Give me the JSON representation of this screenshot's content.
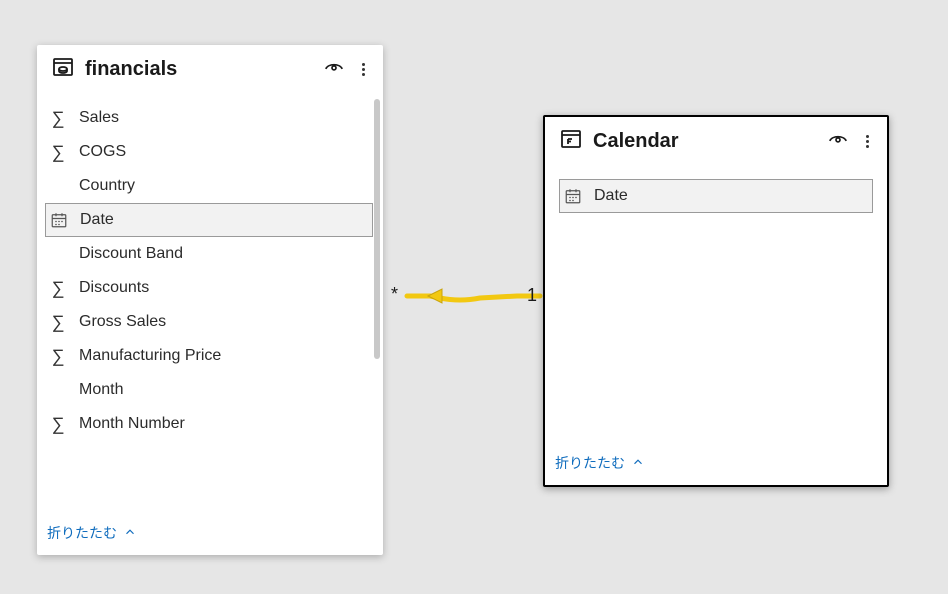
{
  "tables": {
    "financials": {
      "title": "financials",
      "collapse_label": "折りたたむ",
      "fields": [
        {
          "name": "Sales",
          "icon": "sigma",
          "highlight": false
        },
        {
          "name": "COGS",
          "icon": "sigma",
          "highlight": false
        },
        {
          "name": "Country",
          "icon": null,
          "highlight": false
        },
        {
          "name": "Date",
          "icon": "calendar",
          "highlight": true
        },
        {
          "name": "Discount Band",
          "icon": null,
          "highlight": false
        },
        {
          "name": "Discounts",
          "icon": "sigma",
          "highlight": false
        },
        {
          "name": "Gross Sales",
          "icon": "sigma",
          "highlight": false
        },
        {
          "name": "Manufacturing Price",
          "icon": "sigma",
          "highlight": false
        },
        {
          "name": "Month",
          "icon": null,
          "highlight": false
        },
        {
          "name": "Month Number",
          "icon": "sigma",
          "highlight": false
        }
      ]
    },
    "calendar": {
      "title": "Calendar",
      "collapse_label": "折りたたむ",
      "fields": [
        {
          "name": "Date",
          "icon": "calendar",
          "highlight": true
        }
      ]
    }
  },
  "relationship": {
    "left_cardinality": "*",
    "right_cardinality": "1"
  }
}
